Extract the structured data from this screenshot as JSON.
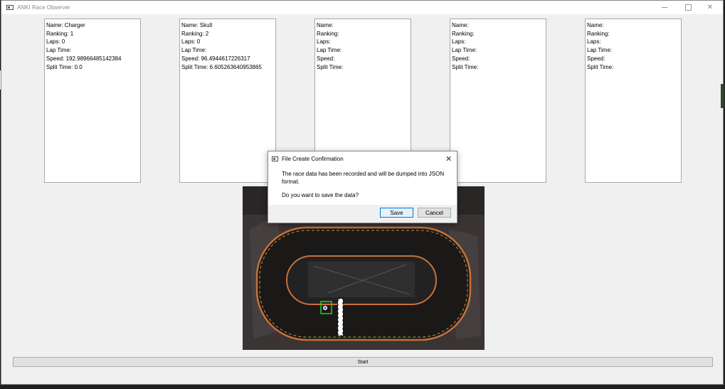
{
  "window": {
    "title": "ANKI Race Observer"
  },
  "cards": [
    {
      "name": "Name: Charger",
      "ranking": "Ranking: 1",
      "laps": "Laps: 0",
      "lap_time": "Lap Time:",
      "speed": "Speed: 192.98966485142384",
      "split": "Split Time: 0.0"
    },
    {
      "name": "Name: Skull",
      "ranking": "Ranking: 2",
      "laps": "Laps: 0",
      "lap_time": "Lap Time:",
      "speed": "Speed: 96.4944617226317",
      "split": "Split Time: 6.605263640953865"
    },
    {
      "name": "Name:",
      "ranking": "Ranking:",
      "laps": "Laps:",
      "lap_time": "Lap Time:",
      "speed": "Speed:",
      "split": "Split Time:"
    },
    {
      "name": "Name:",
      "ranking": "Ranking:",
      "laps": "Laps:",
      "lap_time": "Lap Time:",
      "speed": "Speed:",
      "split": "Split Time:"
    },
    {
      "name": "Name:",
      "ranking": "Ranking:",
      "laps": "Laps:",
      "lap_time": "Lap Time:",
      "speed": "Speed:",
      "split": "Split Time:"
    }
  ],
  "start_label": "Start",
  "dialog": {
    "title": "File Create Confirmation",
    "message": "The race data has been recorded and will be dumped into JSON format.",
    "question": "Do you want to save the data?",
    "save_label": "Save",
    "cancel_label": "Cancel"
  },
  "icons": {
    "close": "close-icon",
    "minimize": "minimize-icon",
    "maximize": "maximize-icon",
    "app": "app-icon"
  }
}
